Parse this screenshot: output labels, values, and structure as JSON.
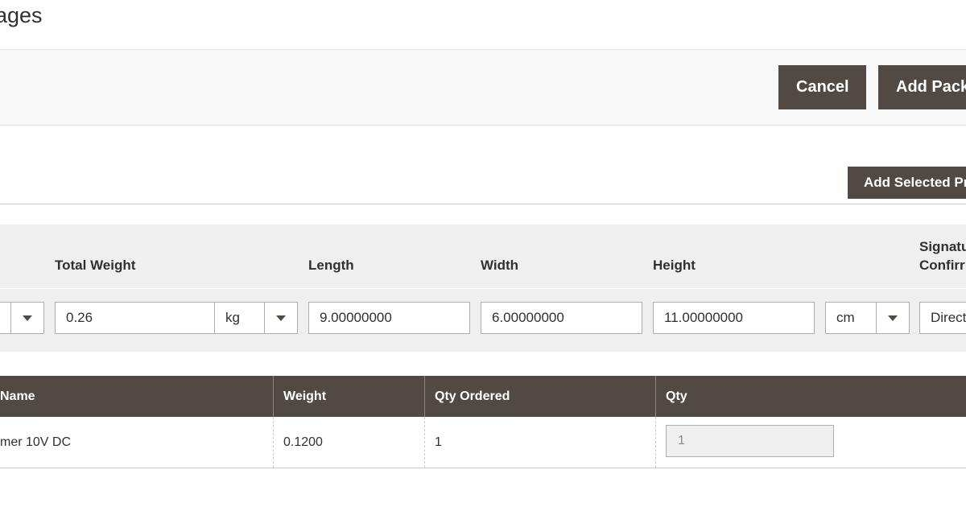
{
  "page": {
    "title": "ages"
  },
  "actions": {
    "cancel_label": "Cancel",
    "add_package_label": "Add Pack"
  },
  "package": {
    "add_selected_label": "Add Selected Pr",
    "headers": {
      "total_weight": "Total Weight",
      "length": "Length",
      "width": "Width",
      "height": "Height",
      "signature_line1": "Signatu",
      "signature_line2": "Confirr"
    },
    "values": {
      "total_weight": "0.26",
      "weight_unit": "kg",
      "length": "9.00000000",
      "width": "6.00000000",
      "height": "11.00000000",
      "dimension_unit": "cm",
      "signature": "Direct"
    }
  },
  "items": {
    "columns": [
      "Name",
      "Weight",
      "Qty Ordered",
      "Qty"
    ],
    "rows": [
      {
        "name": "mer 10V DC",
        "weight": "0.1200",
        "qty_ordered": "1",
        "qty": "1"
      }
    ]
  },
  "colors": {
    "dark_button": "#514943",
    "panel_bg": "#efefef",
    "header_bg": "#514943"
  }
}
